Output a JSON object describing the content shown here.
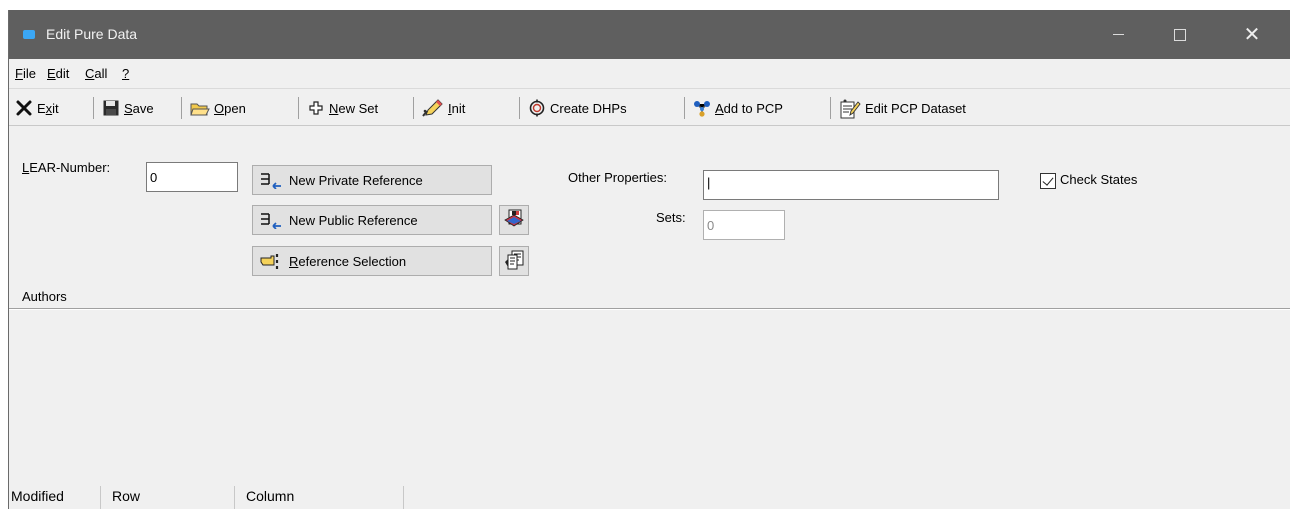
{
  "window": {
    "title": "Edit Pure Data",
    "minimize": "—",
    "maximize": "☐",
    "close": "✕"
  },
  "menu": [
    {
      "label": "File",
      "accel": "F",
      "rest": "ile"
    },
    {
      "label": "Edit",
      "accel": "E",
      "rest": "dit"
    },
    {
      "label": "Call",
      "accel": "C",
      "rest": "all"
    },
    {
      "label": "?",
      "accel": "?",
      "rest": ""
    }
  ],
  "toolbar": {
    "exit": {
      "accel": "x",
      "pre": "E",
      "post": "it"
    },
    "save": {
      "accel": "S",
      "pre": "",
      "post": "ave"
    },
    "open": {
      "accel": "O",
      "pre": "",
      "post": "pen"
    },
    "new_set": {
      "accel": "N",
      "pre": "",
      "post": "ew Set"
    },
    "init": {
      "accel": "I",
      "pre": "",
      "post": "nit"
    },
    "create_dhps": "Create DHPs",
    "add_to_pcp": {
      "accel": "A",
      "pre": "",
      "post": "dd to PCP"
    },
    "edit_pcp_dataset": "Edit PCP Dataset"
  },
  "form": {
    "lear_label_accel": "L",
    "lear_label_rest": "EAR-Number:",
    "lear_value": "0",
    "new_private_reference": "New Private Reference",
    "new_public_reference": "New Public Reference",
    "reference_selection_accel": "R",
    "reference_selection_rest": "eference Selection",
    "other_properties_label": "Other Properties:",
    "other_properties_value": "|",
    "sets_label": "Sets:",
    "sets_value": "0",
    "check_states_label": "Check States",
    "check_states_checked": true,
    "authors_label": "Authors"
  },
  "status": {
    "modified": "Modified",
    "row": "Row",
    "column": "Column"
  },
  "colors": {
    "titlebar": "#5f5f5f",
    "app_icon": "#3ba7f5",
    "window_bg": "#f0f0f0",
    "button_bg": "#e1e1e1"
  },
  "icons": {
    "exit": "x-mark-icon",
    "save": "floppy-disk-icon",
    "open": "folder-open-icon",
    "new_set": "plus-cross-icon",
    "init": "pencil-eraser-icon",
    "create_dhps": "circle-arrows-icon",
    "add_to_pcp": "molecule-icon",
    "edit_pcp_dataset": "document-edit-icon",
    "reference": "list-arrow-icon",
    "public_action": "book-card-icon",
    "selection": "pointing-hand-icon",
    "selection_action": "document-stack-icon"
  }
}
